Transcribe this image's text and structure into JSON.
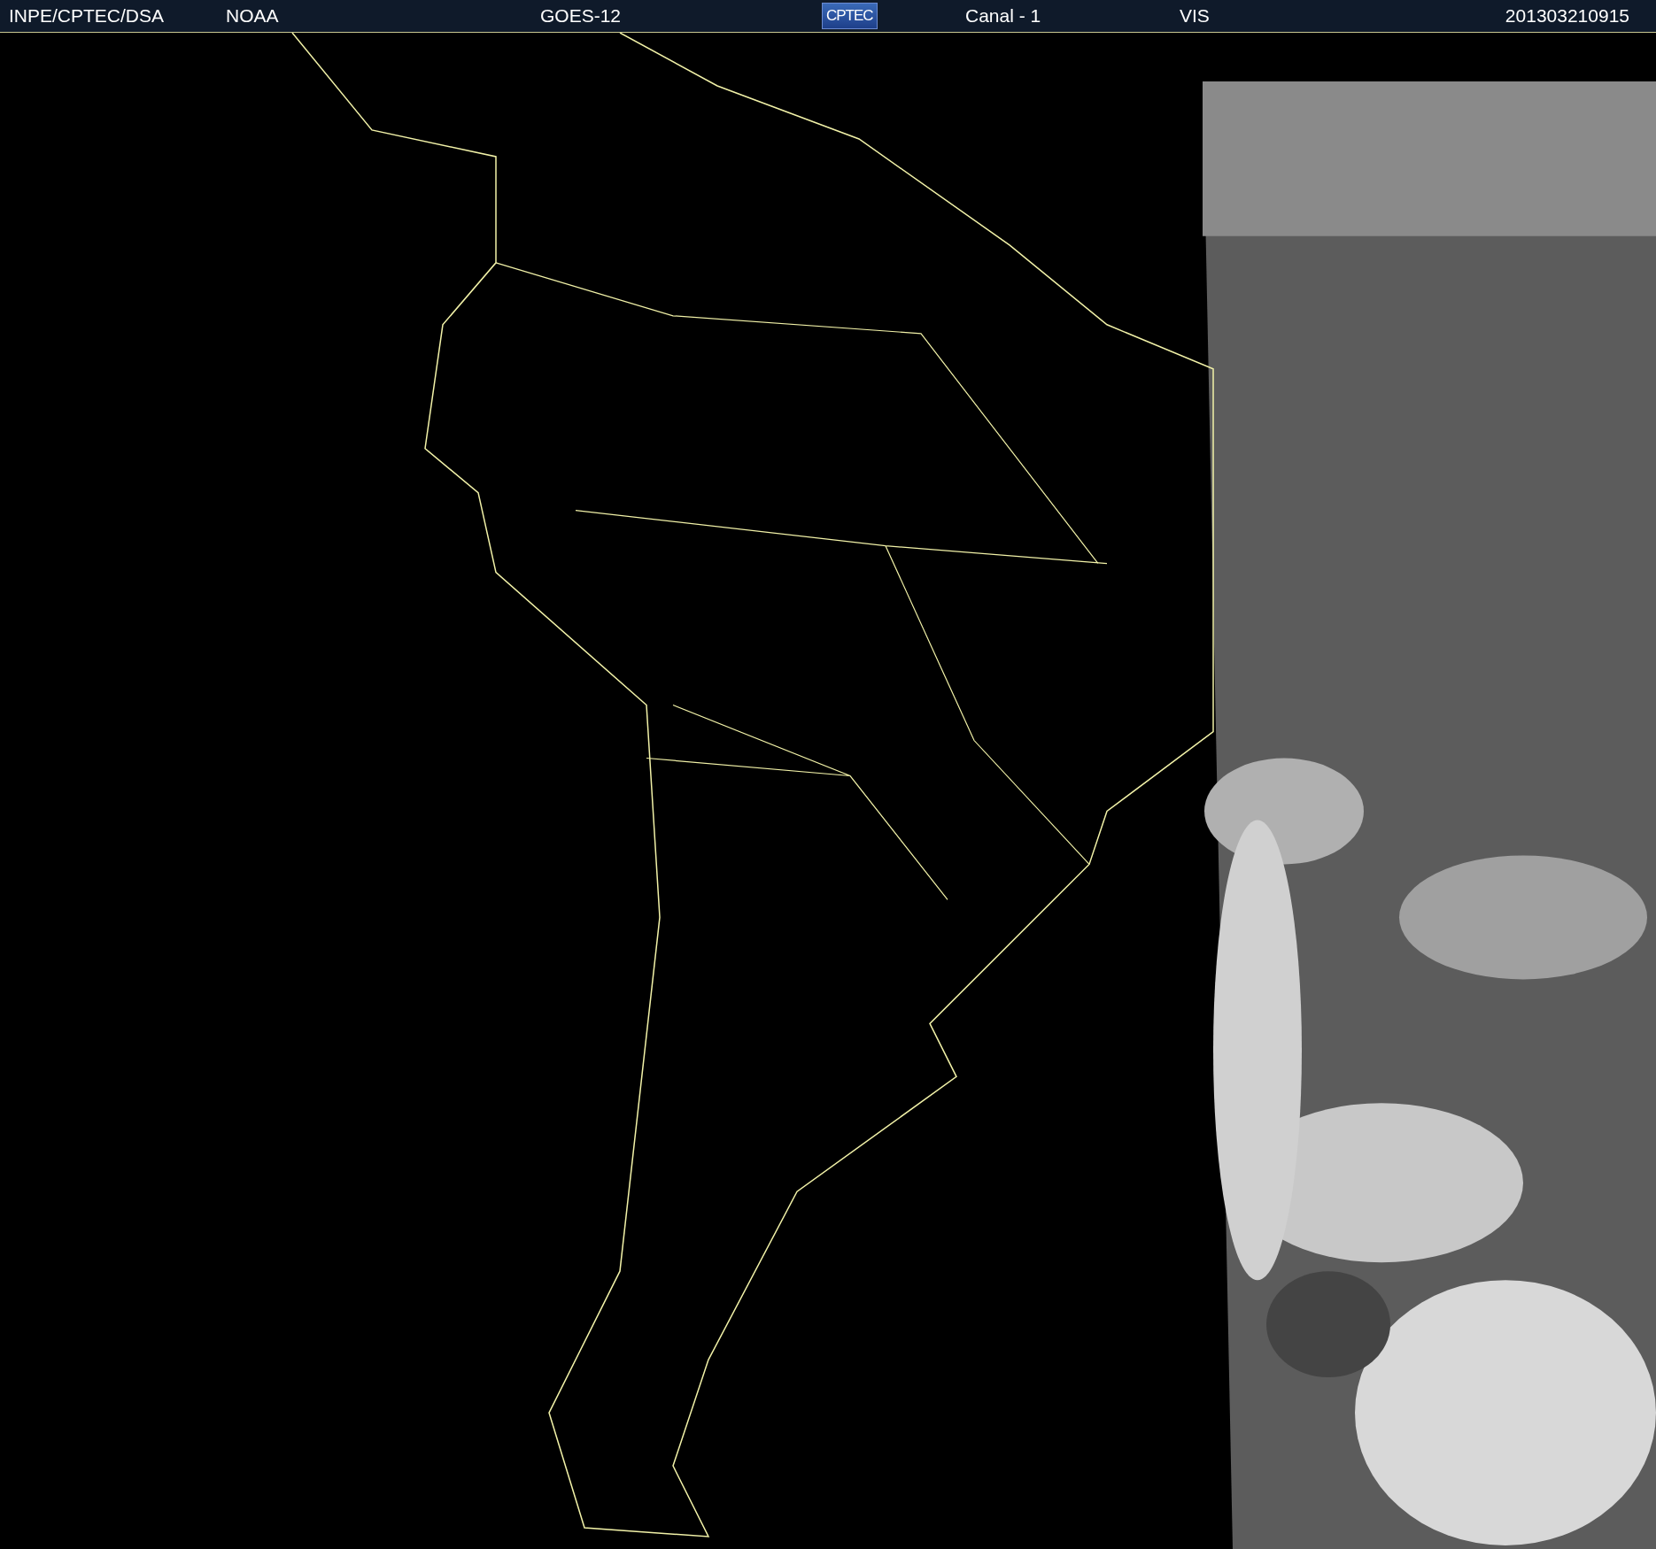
{
  "header": {
    "items": [
      {
        "kind": "text",
        "label": "INPE/CPTEC/DSA"
      },
      {
        "kind": "text",
        "label": "NOAA"
      },
      {
        "kind": "text",
        "label": "GOES-12"
      },
      {
        "kind": "logo",
        "label": "CPTEC"
      },
      {
        "kind": "text",
        "label": "Canal - 1"
      },
      {
        "kind": "text",
        "label": "VIS"
      },
      {
        "kind": "date",
        "label": "201303210915"
      }
    ]
  }
}
